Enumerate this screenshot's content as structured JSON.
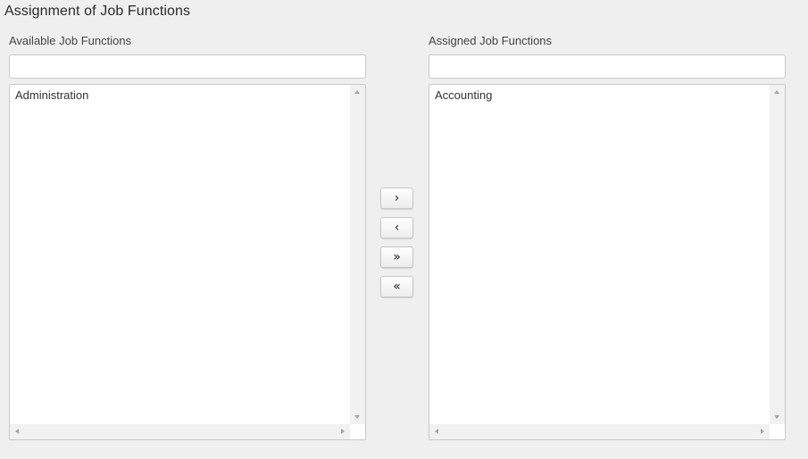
{
  "title": "Assignment of Job Functions",
  "available": {
    "label": "Available Job Functions",
    "filter_value": "",
    "filter_placeholder": "",
    "items": [
      "Administration"
    ]
  },
  "assigned": {
    "label": "Assigned Job Functions",
    "filter_value": "",
    "filter_placeholder": "",
    "items": [
      "Accounting"
    ]
  },
  "buttons": {
    "move_right": "›",
    "move_left": "‹",
    "move_all_right": "»",
    "move_all_left": "«"
  }
}
